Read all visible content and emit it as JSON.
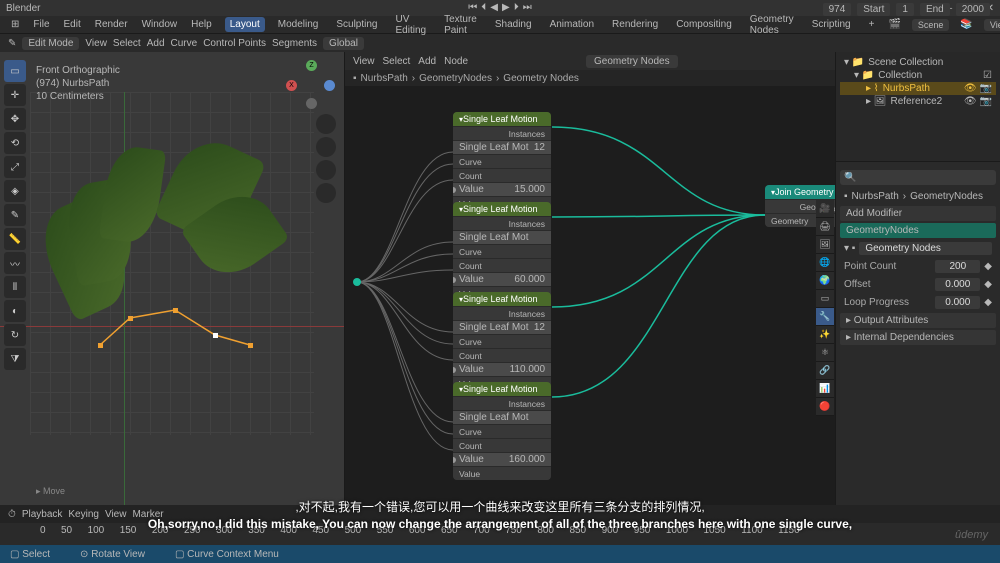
{
  "app": {
    "title": "Blender"
  },
  "menu": {
    "logo": "⊞",
    "file": "File",
    "edit": "Edit",
    "render": "Render",
    "window": "Window",
    "help": "Help"
  },
  "workspaces": {
    "layout": "Layout",
    "modeling": "Modeling",
    "sculpting": "Sculpting",
    "uv": "UV Editing",
    "texture": "Texture Paint",
    "shading": "Shading",
    "animation": "Animation",
    "rendering": "Rendering",
    "compositing": "Compositing",
    "geonodes": "Geometry Nodes",
    "scripting": "Scripting",
    "plus": "+"
  },
  "header_right": {
    "scene_ico": "🎬",
    "scene": "Scene",
    "layer_ico": "📚",
    "layer": "ViewLayer"
  },
  "toolbar": {
    "mode_ico": "✎",
    "mode": "Edit Mode",
    "view": "View",
    "select": "Select",
    "add": "Add",
    "curve": "Curve",
    "control": "Control Points",
    "segments": "Segments",
    "orient": "Global"
  },
  "vp": {
    "l1": "Front Orthographic",
    "l2": "(974) NurbsPath",
    "l3": "10 Centimeters",
    "move": "▸ Move"
  },
  "ne": {
    "menu": {
      "view": "View",
      "select": "Select",
      "add": "Add",
      "node": "Node",
      "group": "Geometry Nodes"
    },
    "bc": {
      "a": "NurbsPath",
      "b": "GeometryNodes",
      "c": "Geometry Nodes"
    },
    "nodes": [
      {
        "title": "Single Leaf Motion",
        "out": "Instances",
        "field": "Single Leaf Mot",
        "num": "12",
        "rows": [
          "Curve",
          "Count"
        ],
        "val": "15.000",
        "val2": "Value"
      },
      {
        "title": "Single Leaf Motion",
        "out": "Instances",
        "field": "Single Leaf Mot",
        "num": "",
        "rows": [
          "Curve",
          "Count"
        ],
        "val": "60.000",
        "val2": "Value"
      },
      {
        "title": "Single Leaf Motion",
        "out": "Instances",
        "field": "Single Leaf Mot",
        "num": "12",
        "rows": [
          "Curve",
          "Count"
        ],
        "val": "110.000",
        "val2": "Value"
      },
      {
        "title": "Single Leaf Motion",
        "out": "Instances",
        "field": "Single Leaf Mot",
        "num": "",
        "rows": [
          "Curve",
          "Count"
        ],
        "val": "160.000",
        "val2": "Value"
      }
    ],
    "join": {
      "title": "Join Geometry",
      "out": "Geometry",
      "in": "Geometry"
    }
  },
  "outliner": {
    "title": "Scene Collection",
    "coll": "Collection",
    "nurbs": "NurbsPath",
    "ref": "Reference2"
  },
  "props": {
    "bc_a": "NurbsPath",
    "bc_b": "GeometryNodes",
    "addmod": "Add Modifier",
    "gn_head": "GeometryNodes",
    "gn_name": "Geometry Nodes",
    "rows": [
      {
        "l": "Point Count",
        "v": "200"
      },
      {
        "l": "Offset",
        "v": "0.000"
      },
      {
        "l": "Loop Progress",
        "v": "0.000"
      }
    ],
    "out_attr": "▸ Output Attributes",
    "int_dep": "▸ Internal Dependencies"
  },
  "timeline": {
    "playback": "Playback",
    "keying": "Keying",
    "view": "View",
    "marker": "Marker",
    "ticks": [
      "0",
      "50",
      "100",
      "150",
      "200",
      "250",
      "300",
      "350",
      "400",
      "450",
      "500",
      "550",
      "600",
      "650",
      "700",
      "750",
      "800",
      "850",
      "900",
      "950",
      "1000",
      "1050",
      "1100",
      "1150"
    ],
    "frame": "974",
    "start_l": "Start",
    "start": "1",
    "end_l": "End",
    "end": "2000"
  },
  "status": {
    "select": "▢ Select",
    "rotate": "⊙ Rotate View",
    "ctx": "▢ Curve Context Menu"
  },
  "subtitle": {
    "cn": ",对不起,我有一个错误,您可以用一个曲线来改变这里所有三条分支的排列情况,",
    "en": "Oh,sorry,no,I did this mistake, You can now change the arrangement of all of the three branches here with one single curve,"
  },
  "brand": "ûdemy"
}
